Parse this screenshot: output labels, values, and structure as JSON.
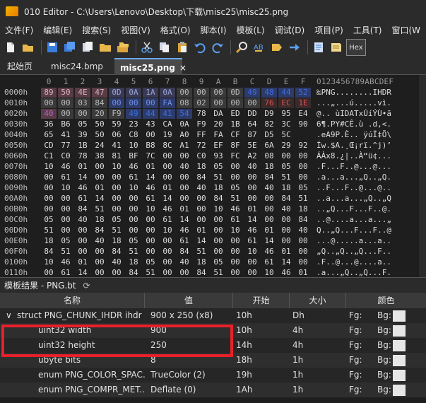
{
  "title": "010 Editor - C:\\Users\\Lenovo\\Desktop\\下载\\misc25\\misc25.png",
  "menu": [
    "文件(F)",
    "编辑(E)",
    "搜索(S)",
    "视图(V)",
    "格式(O)",
    "脚本(I)",
    "模板(L)",
    "调试(D)",
    "项目(P)",
    "工具(T)",
    "窗口(W"
  ],
  "toolbar": {
    "icons": [
      "new-file-icon",
      "open-folder-icon",
      "save-icon",
      "save-all-icon",
      "open-copy-icon",
      "folder-icon",
      "folders-icon",
      "cut-icon",
      "copy-icon",
      "paste-icon",
      "undo-icon",
      "redo-icon",
      "find-icon",
      "replace-icon",
      "find-next-icon",
      "goto-icon",
      "script-icon",
      "template-icon",
      "hex-icon"
    ],
    "hex_label": "Hex"
  },
  "tabs": [
    {
      "label": "起始页",
      "active": false
    },
    {
      "label": "misc24.bmp",
      "active": false
    },
    {
      "label": "misc25.png",
      "active": true,
      "close": "×"
    }
  ],
  "hex": {
    "header": [
      "0",
      "1",
      "2",
      "3",
      "4",
      "5",
      "6",
      "7",
      "8",
      "9",
      "A",
      "B",
      "C",
      "D",
      "E",
      "F"
    ],
    "ascii_header": "0123456789ABCDEF",
    "rows": [
      {
        "addr": "0000h",
        "bytes": [
          "89",
          "50",
          "4E",
          "47",
          "0D",
          "0A",
          "1A",
          "0A",
          "00",
          "00",
          "00",
          "0D",
          "49",
          "48",
          "44",
          "52"
        ],
        "ascii": "‰PNG........IHDR"
      },
      {
        "addr": "0010h",
        "bytes": [
          "00",
          "00",
          "03",
          "84",
          "00",
          "00",
          "00",
          "FA",
          "08",
          "02",
          "00",
          "00",
          "00",
          "76",
          "EC",
          "1E"
        ],
        "ascii": "...„...ú.....vì."
      },
      {
        "addr": "0020h",
        "bytes": [
          "40",
          "00",
          "00",
          "20",
          "F9",
          "49",
          "44",
          "41",
          "54",
          "78",
          "DA",
          "ED",
          "DD",
          "D9",
          "95",
          "E4"
        ],
        "ascii": "@.. ùIDATxÚíÝÙ•ä"
      },
      {
        "addr": "0030h",
        "bytes": [
          "36",
          "B6",
          "05",
          "50",
          "59",
          "23",
          "43",
          "CA",
          "0A",
          "F9",
          "20",
          "1B",
          "64",
          "82",
          "3C",
          "90"
        ],
        "ascii": "6¶.PY#CÊ.ù .d‚<."
      },
      {
        "addr": "0040h",
        "bytes": [
          "65",
          "41",
          "39",
          "50",
          "06",
          "C8",
          "00",
          "19",
          "A0",
          "FF",
          "FA",
          "CF",
          "87",
          "D5",
          "5C"
        ],
        "ascii": ".eA9P.È.. ÿúÏ‡Õ\\"
      },
      {
        "addr": "0050h",
        "bytes": [
          "CD",
          "77",
          "1B",
          "24",
          "41",
          "10",
          "B8",
          "8C",
          "A1",
          "72",
          "EF",
          "8F",
          "5E",
          "6A",
          "29",
          "92"
        ],
        "ascii": "Íw.$A.¸Œ¡rï.^j)’"
      },
      {
        "addr": "0060h",
        "bytes": [
          "C1",
          "C0",
          "78",
          "38",
          "81",
          "BF",
          "7C",
          "00",
          "00",
          "C0",
          "93",
          "FC",
          "A2",
          "08",
          "00",
          "00"
        ],
        "ascii": "ÁÀx8.¿|..À“ü¢..."
      },
      {
        "addr": "0070h",
        "bytes": [
          "10",
          "46",
          "01",
          "00",
          "10",
          "46",
          "01",
          "00",
          "40",
          "18",
          "05",
          "00",
          "40",
          "18",
          "05",
          "00"
        ],
        "ascii": ".F...F..@...@..."
      },
      {
        "addr": "0080h",
        "bytes": [
          "00",
          "61",
          "14",
          "00",
          "00",
          "61",
          "14",
          "00",
          "00",
          "84",
          "51",
          "00",
          "00",
          "84",
          "51",
          "00"
        ],
        "ascii": ".a...a...„Q..„Q."
      },
      {
        "addr": "0090h",
        "bytes": [
          "00",
          "10",
          "46",
          "01",
          "00",
          "10",
          "46",
          "01",
          "00",
          "40",
          "18",
          "05",
          "00",
          "40",
          "18",
          "05"
        ],
        "ascii": "..F...F..@...@.."
      },
      {
        "addr": "00A0h",
        "bytes": [
          "00",
          "00",
          "61",
          "14",
          "00",
          "00",
          "61",
          "14",
          "00",
          "00",
          "84",
          "51",
          "00",
          "00",
          "84",
          "51"
        ],
        "ascii": "..a...a...„Q..„Q"
      },
      {
        "addr": "00B0h",
        "bytes": [
          "00",
          "00",
          "84",
          "51",
          "00",
          "00",
          "10",
          "46",
          "01",
          "00",
          "10",
          "46",
          "01",
          "00",
          "40",
          "18"
        ],
        "ascii": "..„Q...F...F..@."
      },
      {
        "addr": "00C0h",
        "bytes": [
          "05",
          "00",
          "40",
          "18",
          "05",
          "00",
          "00",
          "61",
          "14",
          "00",
          "00",
          "61",
          "14",
          "00",
          "00",
          "84"
        ],
        "ascii": "..@....a...a...„"
      },
      {
        "addr": "00D0h",
        "bytes": [
          "51",
          "00",
          "00",
          "84",
          "51",
          "00",
          "00",
          "10",
          "46",
          "01",
          "00",
          "10",
          "46",
          "01",
          "00",
          "40"
        ],
        "ascii": "Q..„Q...F...F..@"
      },
      {
        "addr": "00E0h",
        "bytes": [
          "18",
          "05",
          "00",
          "40",
          "18",
          "05",
          "00",
          "00",
          "61",
          "14",
          "00",
          "00",
          "61",
          "14",
          "00",
          "00"
        ],
        "ascii": "...@.....a...a.."
      },
      {
        "addr": "00F0h",
        "bytes": [
          "84",
          "51",
          "00",
          "00",
          "84",
          "51",
          "00",
          "00",
          "84",
          "51",
          "00",
          "00",
          "10",
          "46",
          "01",
          "00"
        ],
        "ascii": "„Q..„Q..„Q...F.."
      },
      {
        "addr": "0100h",
        "bytes": [
          "10",
          "46",
          "01",
          "00",
          "40",
          "18",
          "05",
          "00",
          "40",
          "18",
          "05",
          "00",
          "00",
          "61",
          "14",
          "00"
        ],
        "ascii": ".F..@...@....a.."
      },
      {
        "addr": "0110h",
        "bytes": [
          "00",
          "61",
          "14",
          "00",
          "00",
          "84",
          "51",
          "00",
          "00",
          "84",
          "51",
          "00",
          "00",
          "10",
          "46",
          "01"
        ],
        "ascii": ".a...„Q..„Q...F."
      }
    ]
  },
  "template_panel": {
    "title": "模板结果 - PNG.bt",
    "refresh_icon": "refresh-icon",
    "columns": [
      "名称",
      "值",
      "开始",
      "大小",
      "颜色"
    ],
    "rows": [
      {
        "name": "struct PNG_CHUNK_IHDR ihdr",
        "value": "900 x 250 (x8)",
        "start": "10h",
        "size": "Dh",
        "fg": "Fg:",
        "bg": "Bg:",
        "expanded": true,
        "expander": "∨"
      },
      {
        "name": "uint32 width",
        "value": "900",
        "start": "10h",
        "size": "4h",
        "fg": "Fg:",
        "bg": "Bg:"
      },
      {
        "name": "uint32 height",
        "value": "250",
        "start": "14h",
        "size": "4h",
        "fg": "Fg:",
        "bg": "Bg:"
      },
      {
        "name": "ubyte bits",
        "value": "8",
        "start": "18h",
        "size": "1h",
        "fg": "Fg:",
        "bg": "Bg:"
      },
      {
        "name": "enum PNG_COLOR_SPAC...",
        "value": "TrueColor (2)",
        "start": "19h",
        "size": "1h",
        "fg": "Fg:",
        "bg": "Bg:"
      },
      {
        "name": "enum PNG_COMPR_MET...",
        "value": "Deflate (0)",
        "start": "1Ah",
        "size": "1h",
        "fg": "Fg:",
        "bg": "Bg:"
      }
    ]
  },
  "colors": {
    "highlight_pink": "#5a3c46",
    "chunk_type_blue": "#2d3b6b",
    "ihdr_type_text": "#3d6fe0",
    "selection_box": "#e8202a",
    "width_bytes_text": "#aa66cc",
    "crc_text": "#e05050"
  }
}
